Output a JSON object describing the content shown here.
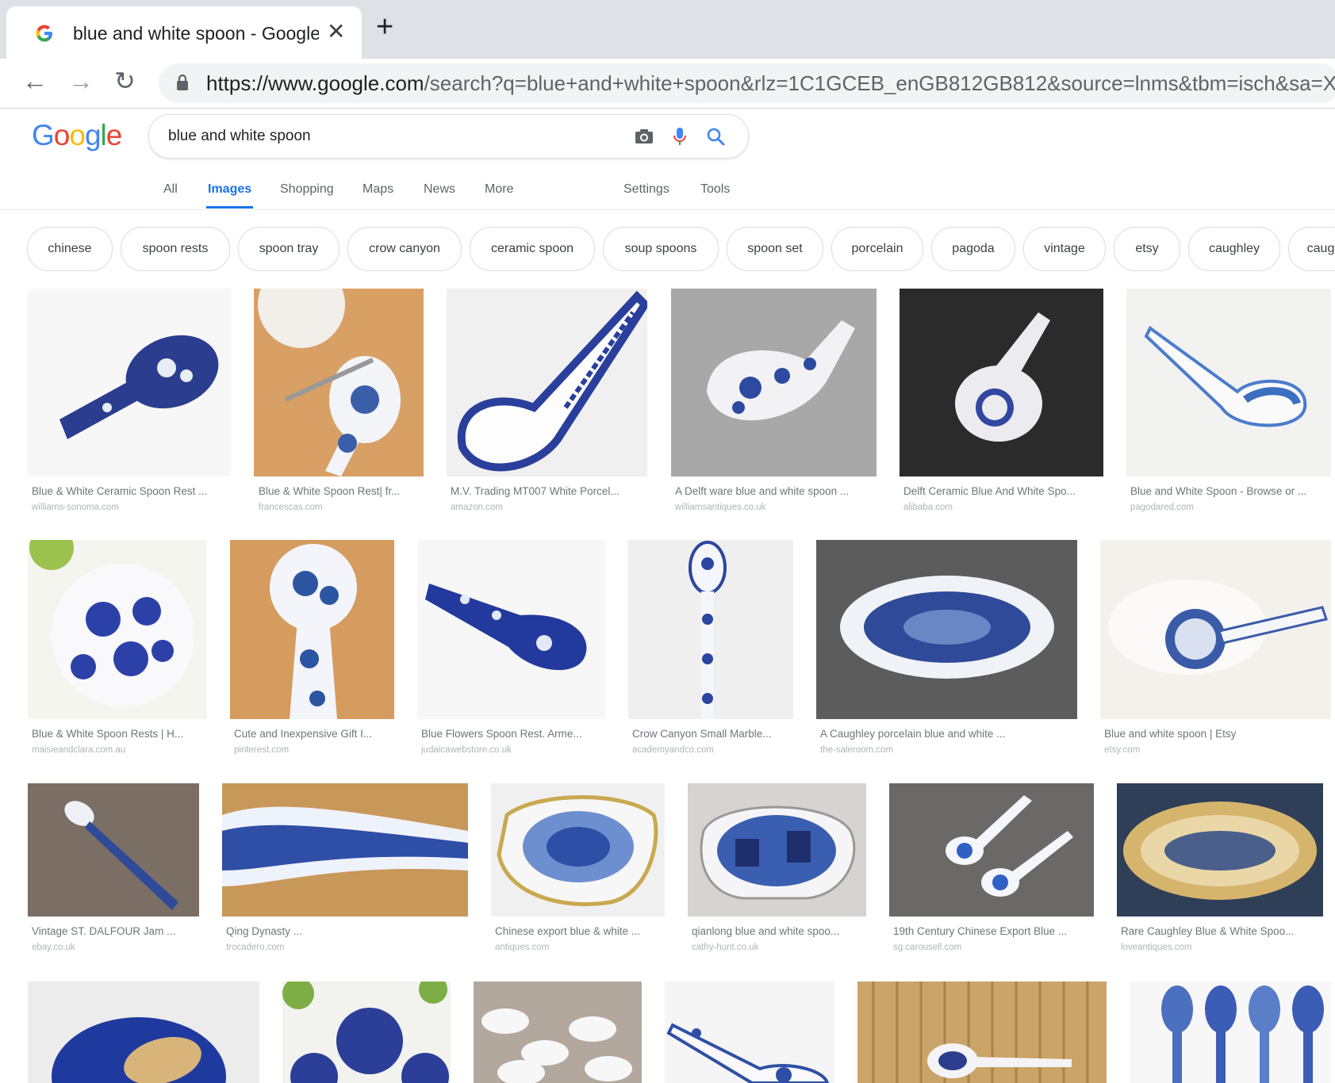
{
  "browser": {
    "tab_title": "blue and white spoon - Google S",
    "url_host": "https://www.google.com",
    "url_rest": "/search?q=blue+and+white+spoon&rlz=1C1GCEB_enGB812GB812&source=lnms&tbm=isch&sa=X&ved"
  },
  "search": {
    "query": "blue and white spoon"
  },
  "nav": {
    "all": "All",
    "images": "Images",
    "shopping": "Shopping",
    "maps": "Maps",
    "news": "News",
    "more": "More",
    "settings": "Settings",
    "tools": "Tools"
  },
  "chips": [
    "chinese",
    "spoon rests",
    "spoon tray",
    "crow canyon",
    "ceramic spoon",
    "soup spoons",
    "spoon set",
    "porcelain",
    "pagoda",
    "vintage",
    "etsy",
    "caughley",
    "caug"
  ],
  "results": [
    {
      "caption": "Blue & White Ceramic Spoon Rest ...",
      "domain": "williams-sonoma.com"
    },
    {
      "caption": "Blue & White Spoon Rest| fr...",
      "domain": "francescas.com"
    },
    {
      "caption": "M.V. Trading MT007 White Porcel...",
      "domain": "amazon.com"
    },
    {
      "caption": "A Delft ware blue and white spoon ...",
      "domain": "williamsantiques.co.uk"
    },
    {
      "caption": "Delft Ceramic Blue And White Spo...",
      "domain": "alibaba.com"
    },
    {
      "caption": "Blue and White Spoon - Browse or ...",
      "domain": "pagodared.com"
    },
    {
      "caption": "Blue & White Spoon Rests | H...",
      "domain": "maisieandclara.com.au"
    },
    {
      "caption": "Cute and Inexpensive Gift I...",
      "domain": "pinterest.com"
    },
    {
      "caption": "Blue Flowers Spoon Rest. Arme...",
      "domain": "judaicawebstore.co.uk"
    },
    {
      "caption": "Crow Canyon Small Marble...",
      "domain": "academyandco.com"
    },
    {
      "caption": "A Caughley porcelain blue and white ...",
      "domain": "the-saleroom.com"
    },
    {
      "caption": "Blue and white spoon | Etsy",
      "domain": "etsy.com"
    },
    {
      "caption": "Vintage ST. DALFOUR Jam ...",
      "domain": "ebay.co.uk"
    },
    {
      "caption": "Qing Dynasty ...",
      "domain": "trocadero.com"
    },
    {
      "caption": "Chinese export blue & white ...",
      "domain": "antiques.com"
    },
    {
      "caption": "qianlong blue and white spoo...",
      "domain": "cathy-hunt.co.uk"
    },
    {
      "caption": "19th Century Chinese Export Blue ...",
      "domain": "sg.carousell.com"
    },
    {
      "caption": "Rare Caughley Blue & White Spoo...",
      "domain": "loveantiques.com"
    }
  ]
}
